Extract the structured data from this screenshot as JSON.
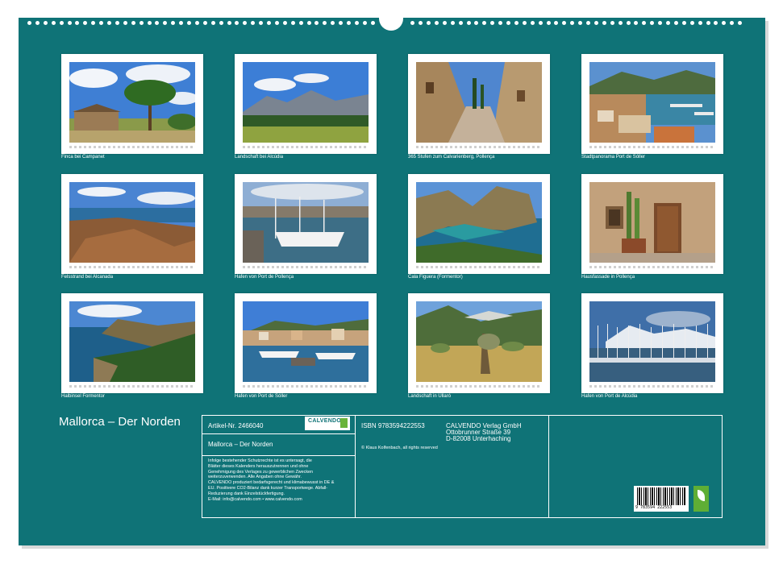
{
  "calendar": {
    "title": "Mallorca – Der Norden",
    "photos": [
      {
        "caption": "Finca bei Campanet"
      },
      {
        "caption": "Landschaft bei Alcúdia"
      },
      {
        "caption": "365 Stufen zum Calvarienberg, Pollença"
      },
      {
        "caption": "Stadtpanorama Port de Sóller"
      },
      {
        "caption": "Felsstrand bei Alcanada"
      },
      {
        "caption": "Hafen von Port de Pollença"
      },
      {
        "caption": "Cala Figuera (Formentor)"
      },
      {
        "caption": "Hausfassade in Pollença"
      },
      {
        "caption": "Halbinsel Formentor"
      },
      {
        "caption": "Hafen von Port de Sóller"
      },
      {
        "caption": "Landschaft in Ullaró"
      },
      {
        "caption": "Hafen von Port de Alcúdia"
      }
    ]
  },
  "info": {
    "article_no": "Artikel-Nr. 2466040",
    "product_title": "Mallorca – Der Norden",
    "logo_text": "CALVENDO",
    "legal_lines": [
      "Infolge bestehender Schutzrechte ist es untersagt, die",
      "Blätter dieses Kalenders herauszutrennen und ohne",
      "Genehmigung des Verlages zu gewerblichen Zwecken",
      "weiterzuverwenden. Alle Angaben ohne Gewähr.",
      "CALVENDO produziert bedarfsgerecht und klimabewusst in DE &",
      "EU. Positivere CO2-Bilanz dank kurzer Transportwege. Abfall-",
      "Reduzierung dank Einzelstückfertigung.",
      "E-Mail: info@calvendo.com • www.calvendo.com"
    ],
    "isbn": "ISBN 9783594222553",
    "publisher": [
      "CALVENDO Verlag GmbH",
      "Ottobrunner Straße 39",
      "D-82008 Unterhaching"
    ],
    "copyright": "© Klaus Kolfenbach, all rights reserved",
    "barcode_number": "9 783594 222553"
  },
  "colors": {
    "background": "#0f7377",
    "frame": "#ffffff"
  }
}
